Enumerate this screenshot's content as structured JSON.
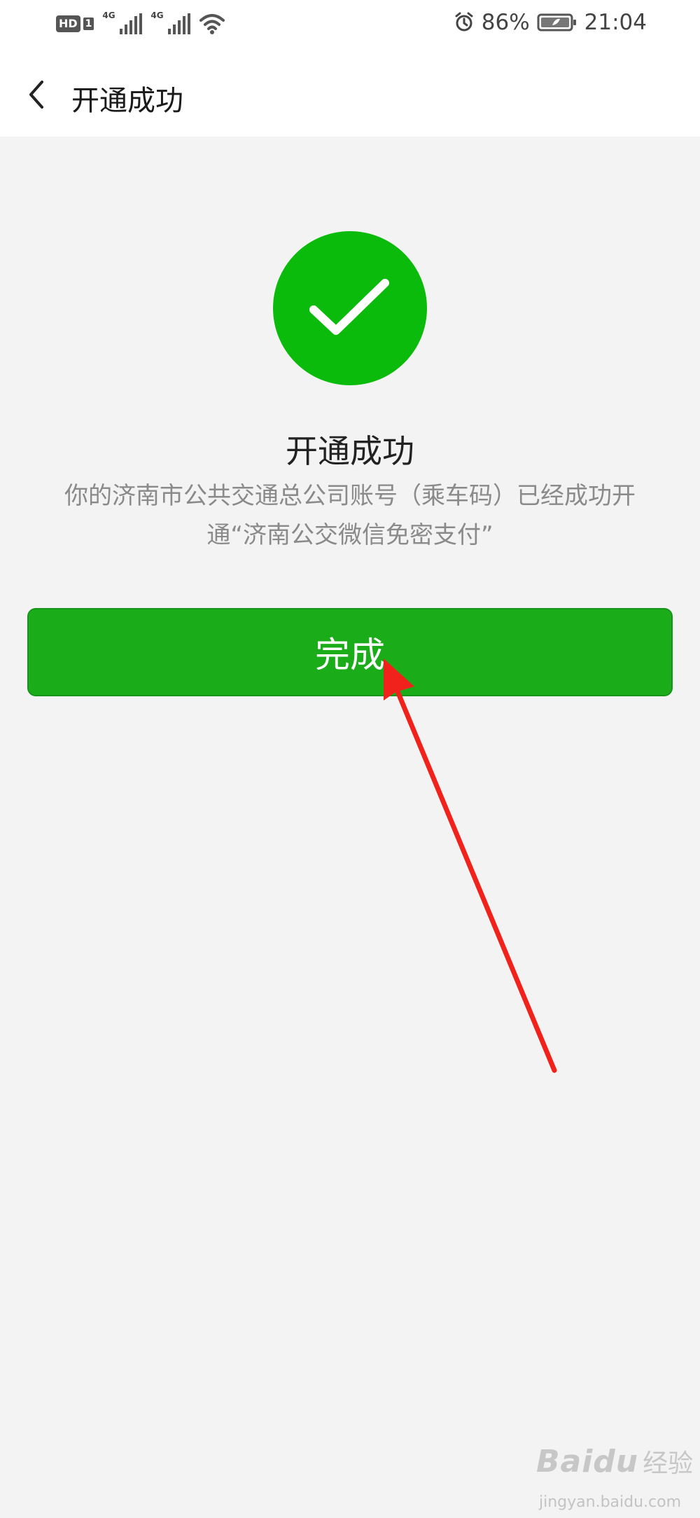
{
  "status_bar": {
    "hd_label": "HD",
    "sim_index": "1",
    "network_1": "4G",
    "network_2": "4G",
    "battery_percent": "86%",
    "time": "21:04",
    "icons": [
      "hd-icon",
      "signal-icon",
      "signal-icon",
      "wifi-icon",
      "alarm-icon",
      "battery-icon"
    ]
  },
  "header": {
    "title": "开通成功",
    "back_icon": "chevron-left-icon"
  },
  "result": {
    "icon": "check-circle-icon",
    "icon_color": "#0bbb0b",
    "title": "开通成功",
    "description": "你的济南市公共交通总公司账号（乘车码）已经成功开通“济南公交微信免密支付”"
  },
  "actions": {
    "done_label": "完成",
    "done_color": "#1aad19"
  },
  "annotation": {
    "arrow_color": "#f0221b"
  },
  "watermark": {
    "brand": "Baidu",
    "brand_cn": "经验",
    "url": "jingyan.baidu.com"
  }
}
